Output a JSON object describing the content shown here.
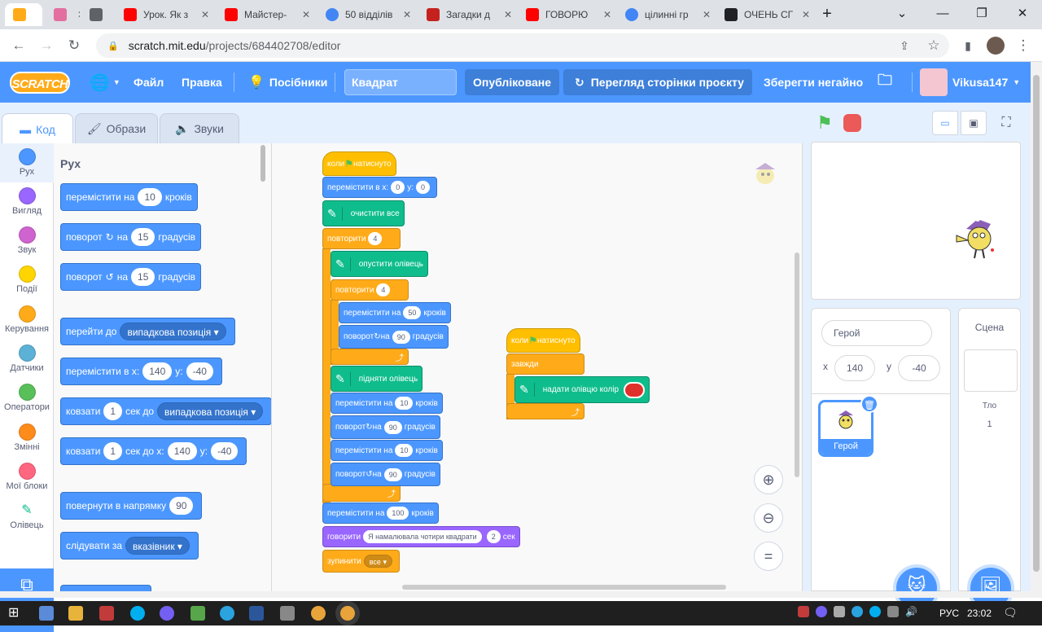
{
  "browser": {
    "tabs": [
      {
        "label": "",
        "fav": "#ffab19"
      },
      {
        "label": "",
        "fav": "#e36fa0"
      },
      {
        "label": "",
        "fav": "#5f6368"
      },
      {
        "label": "Урок. Як з",
        "fav": "#ff0000"
      },
      {
        "label": "Майстер-",
        "fav": "#ff0000"
      },
      {
        "label": "50 відділів",
        "fav": "#4285f4"
      },
      {
        "label": "Загадки д",
        "fav": "#c5221f"
      },
      {
        "label": "ГОВОРЮ",
        "fav": "#ff0000"
      },
      {
        "label": "цілинні гр",
        "fav": "#4285f4"
      },
      {
        "label": "ОЧЕНЬ СГ",
        "fav": "#202124"
      }
    ],
    "new_tab": "+",
    "url_host": "scratch.mit.edu",
    "url_path": "/projects/684402708/editor"
  },
  "menubar": {
    "logo": "SCRATCH",
    "file": "Файл",
    "edit": "Правка",
    "tutorials": "Посібники",
    "project_title": "Квадрат",
    "published": "Опубліковане",
    "see_project": "Перегляд сторінки проєкту",
    "save_now": "Зберегти негайно",
    "username": "Vikusa147",
    "accent": "#4c97ff"
  },
  "editor_tabs": {
    "code": "Код",
    "costumes": "Образи",
    "sounds": "Звуки"
  },
  "categories": [
    {
      "label": "Рух",
      "color": "#4c97ff"
    },
    {
      "label": "Вигляд",
      "color": "#9966ff"
    },
    {
      "label": "Звук",
      "color": "#cf63cf"
    },
    {
      "label": "Події",
      "color": "#ffd500"
    },
    {
      "label": "Керування",
      "color": "#ffab19"
    },
    {
      "label": "Датчики",
      "color": "#5cb1d6"
    },
    {
      "label": "Оператори",
      "color": "#59c059"
    },
    {
      "label": "Змінні",
      "color": "#ff8c1a"
    },
    {
      "label": "Мої блоки",
      "color": "#ff6680"
    },
    {
      "label": "Олівець",
      "color": "#0fbd8c"
    }
  ],
  "palette": {
    "section": "Рух",
    "move": {
      "a": "перемістити на",
      "v": "10",
      "b": "кроків"
    },
    "turn_right": {
      "a": "поворот",
      "b": "на",
      "v": "15",
      "c": "градусів"
    },
    "turn_left": {
      "a": "поворот",
      "b": "на",
      "v": "15",
      "c": "градусів"
    },
    "goto": {
      "a": "перейти до",
      "dd": "випадкова позиція"
    },
    "goto_xy": {
      "a": "перемістити в x:",
      "x": "140",
      "b": "y:",
      "y": "-40"
    },
    "glide": {
      "a": "ковзати",
      "v": "1",
      "b": "сек до",
      "dd": "випадкова позиція"
    },
    "glide_xy": {
      "a": "ковзати",
      "v": "1",
      "b": "сек до x:",
      "x": "140",
      "c": "y:",
      "y": "-40"
    },
    "point_dir": {
      "a": "повернути в напрямку",
      "v": "90"
    },
    "point_towards": {
      "a": "слідувати за",
      "dd": "вказівник"
    }
  },
  "script1": {
    "hat": {
      "a": "коли",
      "b": "натиснуто"
    },
    "goto_xy": {
      "a": "перемістити в x:",
      "x": "0",
      "b": "y:",
      "y": "0"
    },
    "clear": "очистити все",
    "repeat": {
      "a": "повторити",
      "v": "4"
    },
    "pen_down": "опустити олівець",
    "repeat2": {
      "a": "повторити",
      "v": "4"
    },
    "move50": {
      "a": "перемістити на",
      "v": "50",
      "b": "кроків"
    },
    "turn90": {
      "a": "поворот",
      "b": "на",
      "v": "90",
      "c": "градусів"
    },
    "pen_up": "підняти олівець",
    "move10a": {
      "a": "перемістити на",
      "v": "10",
      "b": "кроків"
    },
    "turn90b": {
      "a": "поворот",
      "b": "на",
      "v": "90",
      "c": "градусів"
    },
    "move10b": {
      "a": "перемістити на",
      "v": "10",
      "b": "кроків"
    },
    "turn90c": {
      "a": "поворот",
      "b": "на",
      "v": "90",
      "c": "градусів"
    },
    "move100": {
      "a": "перемістити на",
      "v": "100",
      "b": "кроків"
    },
    "say": {
      "a": "говорити",
      "msg": "Я намалювала чотири квадрати",
      "v": "2",
      "b": "сек"
    },
    "stop": {
      "a": "зупинити",
      "dd": "все"
    }
  },
  "script2": {
    "hat": {
      "a": "коли",
      "b": "натиснуто"
    },
    "forever": "завжди",
    "set_color": "надати олівцю колір",
    "color_value": "#e0302c"
  },
  "sprite_info": {
    "name": "Герой",
    "x_label": "x",
    "x": "140",
    "y_label": "y",
    "y": "-40",
    "thumb_label": "Герой"
  },
  "stage_pane": {
    "title": "Сцена",
    "backdrops_label": "Тло",
    "backdrops_count": "1"
  },
  "taskbar": {
    "lang": "РУС",
    "time": "23:02"
  }
}
